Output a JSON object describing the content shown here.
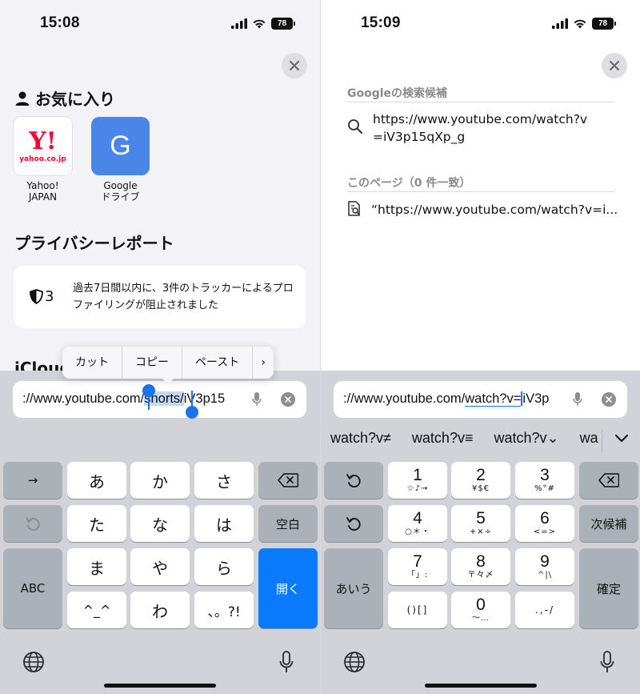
{
  "left": {
    "status": {
      "time": "15:08",
      "battery": "78"
    },
    "favorites": {
      "title": "お気に入り",
      "items": [
        {
          "label": "Yahoo!\nJAPAN",
          "logo_text": "Y!",
          "logo_sub": "yahoo.co.jp"
        },
        {
          "label": "Google\nドライブ",
          "logo_text": "G"
        }
      ]
    },
    "privacy": {
      "title": "プライバシーレポート",
      "count": "3",
      "message": "過去7日間以内に、3件のトラッカーによるプロファイリングが阻止されました"
    },
    "icloud_title": "iCloud",
    "edit_menu": [
      "カット",
      "コピー",
      "ペースト",
      "›"
    ],
    "address": {
      "pre": "://www.youtube.com/",
      "selected": "shorts/",
      "post": "iV3p15"
    },
    "keys": {
      "row1": [
        "→",
        "あ",
        "か",
        "さ"
      ],
      "row2": [
        "た",
        "な",
        "は",
        "空白"
      ],
      "row3": [
        "ABC",
        "ま",
        "や",
        "ら",
        "開く"
      ],
      "row4": [
        "^_^",
        "わ",
        "、。?!"
      ]
    }
  },
  "right": {
    "status": {
      "time": "15:09",
      "battery": "78"
    },
    "google_section": "Googleの検索候補",
    "google_suggestion": "https://www.youtube.com/watch?v=iV3p15qXp_g",
    "page_section": "このページ（0 件一致）",
    "page_suggestion": "“https://www.youtube.com/watch?v=i...",
    "address": {
      "pre": "://www.youtube.com/",
      "underlined": "watch?v=",
      "post": "iV3p"
    },
    "predictions": [
      "watch?v≠",
      "watch?v≡",
      "watch?v⌄",
      "wa"
    ],
    "keys": {
      "k1": {
        "d": "1",
        "s": "☆♪→"
      },
      "k2": {
        "d": "2",
        "s": "¥$€"
      },
      "k3": {
        "d": "3",
        "s": "%°#"
      },
      "k4": {
        "d": "4",
        "s": "○＊・"
      },
      "k5": {
        "d": "5",
        "s": "+×÷"
      },
      "k6": {
        "d": "6",
        "s": "<=>"
      },
      "k7": {
        "d": "7",
        "s": "「」:"
      },
      "k8": {
        "d": "8",
        "s": "〒々〆"
      },
      "k9": {
        "d": "9",
        "s": "^|\\"
      },
      "k0": {
        "d": "0",
        "s": "〜…"
      },
      "kparen": "()[]",
      "kpunct": ".,-/",
      "next": "次候補",
      "kana": "あいう",
      "confirm": "確定"
    }
  },
  "colors": {
    "accent": "#0a7aff",
    "selection": "#c4d7f5",
    "handle": "#1a73e8"
  }
}
